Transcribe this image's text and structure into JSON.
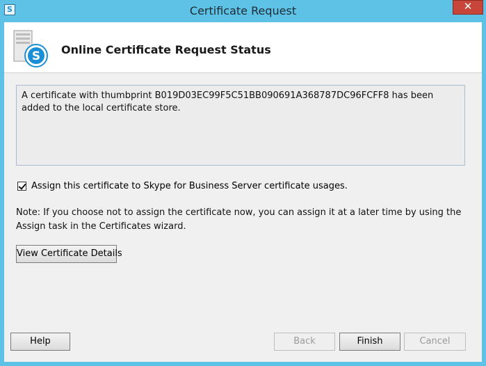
{
  "window": {
    "title": "Certificate Request",
    "close_glyph": "✕"
  },
  "header": {
    "title": "Online Certificate Request Status",
    "icon": "skype-server-icon"
  },
  "message": {
    "text": "A certificate with thumbprint B019D03EC99F5C51BB090691A368787DC96FCFF8 has been added to the local certificate store."
  },
  "assign_checkbox": {
    "checked": true,
    "label": "Assign this certificate to Skype for Business Server certificate usages."
  },
  "note": {
    "text": "Note: If you choose not to assign the certificate now, you can assign it at a later time by using the Assign task in the Certificates wizard."
  },
  "buttons": {
    "view_details": "View Certificate Details",
    "help": "Help",
    "back": "Back",
    "finish": "Finish",
    "cancel": "Cancel"
  },
  "colors": {
    "titlebar": "#5ec2e6",
    "close": "#c8453a",
    "client_bg": "#f0f0f0",
    "skype_blue": "#1a8fd6"
  }
}
